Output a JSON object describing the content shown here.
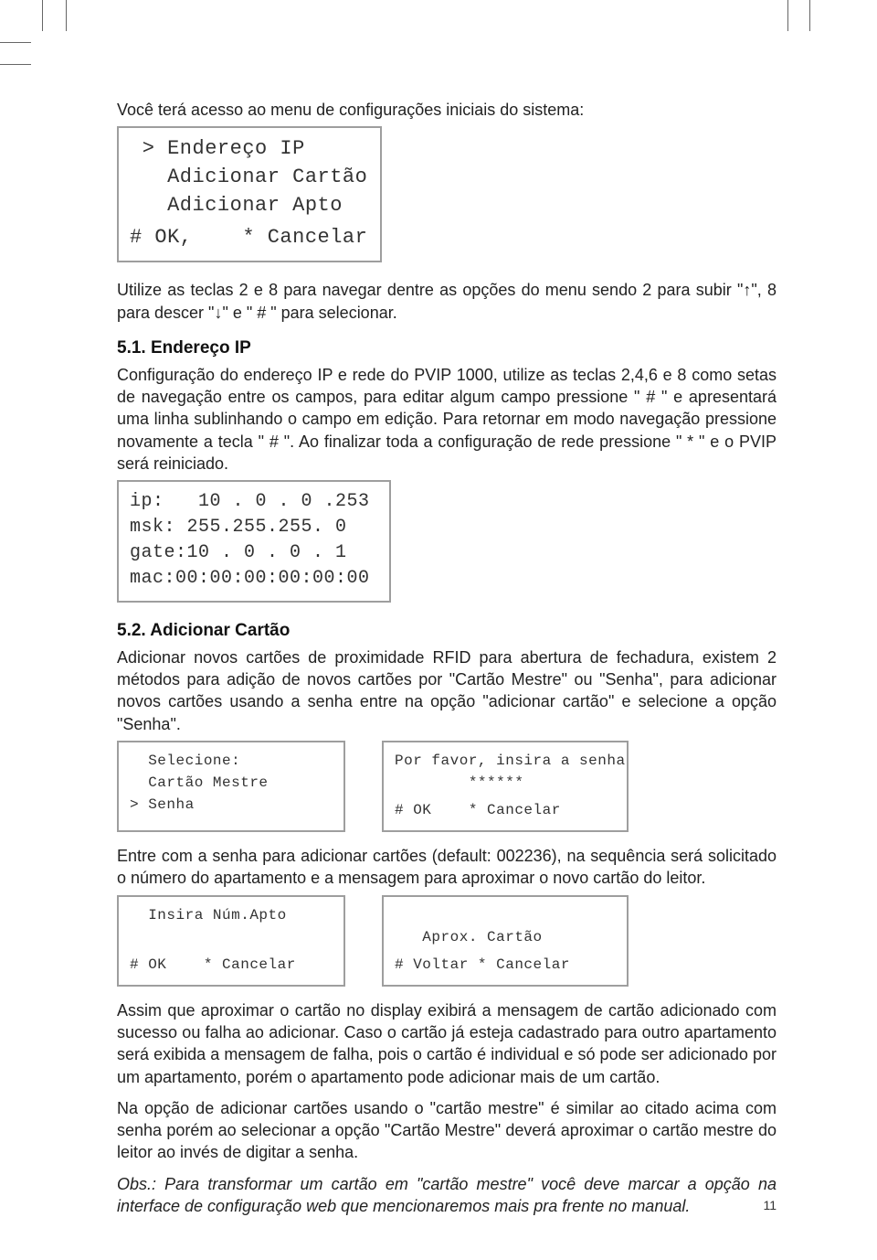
{
  "intro": "Você terá acesso ao menu de configurações iniciais do sistema:",
  "menu1": {
    "line1": " > Endereço IP",
    "line2": "   Adicionar Cartão",
    "line3": "   Adicionar Apto",
    "foot": "# OK,    * Cancelar"
  },
  "nav_text": "Utilize as teclas 2 e 8 para navegar dentre as opções do menu sendo 2 para subir \"↑\", 8 para descer \"↓\" e \" # \" para selecionar.",
  "s51_title": "5.1. Endereço IP",
  "s51_body": "Configuração do endereço IP e rede do PVIP 1000, utilize as teclas 2,4,6 e 8 como setas de navegação entre os campos, para editar algum campo pressione \" # \" e apresentará uma linha sublinhando o campo em edição. Para retornar em modo navegação pressione novamente a tecla \" # \". Ao finalizar toda a configuração de rede pressione \" * \" e o PVIP será reiniciado.",
  "ipbox": {
    "l1": "ip:   10 . 0 . 0 .253",
    "l2": "msk: 255.255.255. 0",
    "l3": "gate:10 . 0 . 0 . 1",
    "l4": "mac:00:00:00:00:00:00"
  },
  "s52_title": "5.2. Adicionar Cartão",
  "s52_body": "Adicionar novos cartões de proximidade RFID para abertura de fechadura, existem 2 métodos para adição de novos cartões por \"Cartão Mestre\" ou \"Senha\", para adicionar novos cartões usando a senha entre na opção \"adicionar cartão\" e selecione a opção \"Senha\".",
  "pairA": {
    "left": {
      "l1": "  Selecione:",
      "l2": "  Cartão Mestre",
      "l3": "> Senha"
    },
    "right": {
      "l1": "Por favor, insira a senha",
      "l2": "        ******",
      "l3": "# OK    * Cancelar"
    }
  },
  "mid_text": "Entre com a senha para adicionar cartões (default: 002236), na sequência será solicitado o número do apartamento e a mensagem para aproximar o novo cartão do leitor.",
  "pairB": {
    "left": {
      "l1": "  Insira Núm.Apto",
      "l2": " ",
      "l3": "# OK    * Cancelar"
    },
    "right": {
      "l1": " ",
      "l2": "   Aprox. Cartão",
      "l3": "# Voltar * Cancelar"
    }
  },
  "after1": "Assim que aproximar o cartão no display exibirá a mensagem de cartão adicionado com sucesso ou falha ao adicionar. Caso o cartão já esteja cadastrado para outro apartamento será exibida a mensagem de falha, pois o cartão é individual e só pode ser adicionado por um apartamento, porém o apartamento pode adicionar mais de um cartão.",
  "after2": "Na opção de adicionar cartões usando o \"cartão mestre\" é similar ao citado acima com senha porém ao selecionar a opção \"Cartão Mestre\" deverá aproximar o cartão mestre do leitor ao invés de digitar a senha.",
  "obs": "Obs.: Para transformar um cartão em \"cartão mestre\" você deve marcar a opção na interface de configuração web que mencionaremos mais pra frente no manual.",
  "page_number": "11"
}
